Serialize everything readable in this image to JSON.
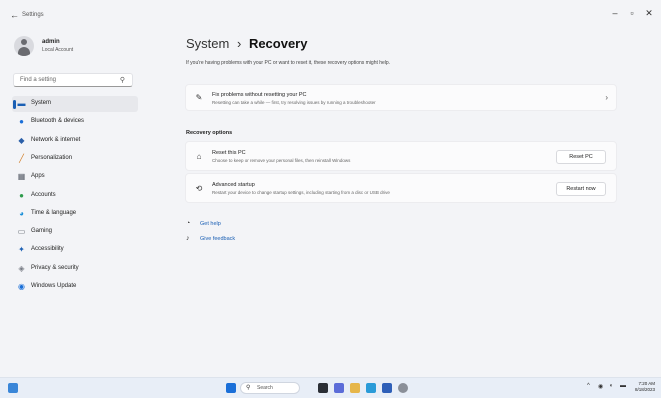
{
  "window": {
    "title": "Settings",
    "back": "←",
    "minimize": "–",
    "maximize": "▫",
    "close": "✕"
  },
  "user": {
    "name": "admin",
    "account_type": "Local Account"
  },
  "search": {
    "placeholder": "Find a setting"
  },
  "nav": [
    {
      "label": "System",
      "icon": "monitor-icon",
      "color": "#1a5fb4",
      "active": true
    },
    {
      "label": "Bluetooth & devices",
      "icon": "bluetooth-icon",
      "color": "#1a6fd8"
    },
    {
      "label": "Network & internet",
      "icon": "wifi-icon",
      "color": "#2b5fa8"
    },
    {
      "label": "Personalization",
      "icon": "brush-icon",
      "color": "#d0781e"
    },
    {
      "label": "Apps",
      "icon": "apps-icon",
      "color": "#555b66"
    },
    {
      "label": "Accounts",
      "icon": "person-icon",
      "color": "#2e9b4c"
    },
    {
      "label": "Time & language",
      "icon": "globe-clock-icon",
      "color": "#1a8fd8"
    },
    {
      "label": "Gaming",
      "icon": "gamepad-icon",
      "color": "#6a6f78"
    },
    {
      "label": "Accessibility",
      "icon": "accessibility-icon",
      "color": "#1a5fb4"
    },
    {
      "label": "Privacy & security",
      "icon": "shield-icon",
      "color": "#777b84"
    },
    {
      "label": "Windows Update",
      "icon": "update-icon",
      "color": "#1a6fd8"
    }
  ],
  "header": {
    "parent": "System",
    "separator": "›",
    "current": "Recovery",
    "subtitle": "If you're having problems with your PC or want to reset it, these recovery options might help."
  },
  "fix_card": {
    "title": "Fix problems without resetting your PC",
    "desc": "Resetting can take a while — first, try resolving issues by running a troubleshooter",
    "chevron": "›"
  },
  "section_label": "Recovery options",
  "reset_card": {
    "title": "Reset this PC",
    "desc": "Choose to keep or remove your personal files, then reinstall Windows",
    "button": "Reset PC"
  },
  "advanced_card": {
    "title": "Advanced startup",
    "desc": "Restart your device to change startup settings, including starting from a disc or USB drive",
    "button": "Restart now"
  },
  "links": {
    "help": "Get help",
    "feedback": "Give feedback"
  },
  "taskbar": {
    "search": "Search",
    "time": "7:20 AM",
    "date": "8/18/2023"
  }
}
